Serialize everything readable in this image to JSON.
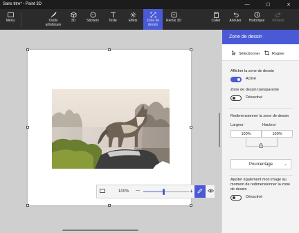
{
  "window": {
    "title": "Sans titre* - Paint 3D",
    "controls": [
      "—",
      "☐",
      "✕"
    ]
  },
  "ribbon": {
    "menu": "Menu",
    "tools": [
      {
        "label": "Outils artistiques",
        "icon": "brush-icon"
      },
      {
        "label": "3D",
        "icon": "cube-icon"
      },
      {
        "label": "Stickers",
        "icon": "sticker-icon"
      },
      {
        "label": "Texte",
        "icon": "text-icon"
      },
      {
        "label": "Effets",
        "icon": "effects-icon"
      },
      {
        "label": "Zone de dessin",
        "icon": "canvas-icon"
      },
      {
        "label": "Remix 3D",
        "icon": "remix-icon"
      }
    ],
    "right": [
      {
        "label": "Coller",
        "icon": "paste-icon"
      },
      {
        "label": "Annuler",
        "icon": "undo-icon"
      },
      {
        "label": "Historique",
        "icon": "history-icon"
      },
      {
        "label": "Rétablir",
        "icon": "redo-icon"
      }
    ],
    "active_tool": "Zone de dessin",
    "accent": "#4a5ad6"
  },
  "zoom": {
    "value": "100%",
    "minus": "—",
    "plus": "+"
  },
  "panel": {
    "title": "Zone de dessin",
    "select_label": "Sélectionner",
    "crop_label": "Rogner",
    "show_canvas_label": "Afficher la zone de dessin",
    "show_canvas_state": "Activé",
    "transparent_label": "Zone de dessin transparente",
    "transparent_state": "Désactivé",
    "resize_label": "Redimensionner la zone de dessin",
    "width_label": "Largeur",
    "height_label": "Hauteur",
    "width_value": "100%",
    "height_value": "100%",
    "unit_select": "Pourcentage",
    "adjust_label": "Ajuster également mon image au moment de redimensionner la zone de dessin",
    "adjust_state": "Désactivé"
  }
}
